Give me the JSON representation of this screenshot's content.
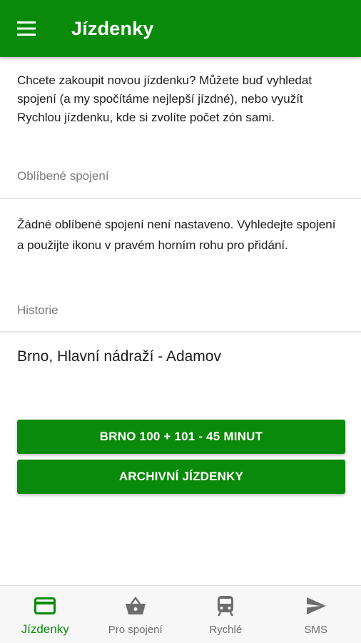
{
  "appbar": {
    "title": "Jízdenky",
    "menu_icon": "hamburger-menu-icon"
  },
  "intro": "Chcete zakoupit novou jízdenku? Můžete buď vyhledat spojení (a my spočítáme nejlepší jízdné), nebo využít Rychlou jízdenku, kde si zvolíte počet zón sami.",
  "favorites": {
    "label": "Oblíbené spojení",
    "empty_text": "Žádné oblíbené spojení není nastaveno. Vyhledejte spojení a použijte ikonu v pravém horním rohu pro přidání."
  },
  "history": {
    "label": "Historie",
    "items": [
      "Brno, Hlavní nádraží - Adamov"
    ]
  },
  "buttons": {
    "ticket_label": "BRNO 100 + 101 - 45 MINUT",
    "archive_label": "ARCHIVNÍ JÍZDENKY"
  },
  "bottom_nav": {
    "items": [
      {
        "label": "Jízdenky",
        "icon": "card-icon",
        "active": true
      },
      {
        "label": "Pro spojení",
        "icon": "basket-icon",
        "active": false
      },
      {
        "label": "Rychlé",
        "icon": "train-icon",
        "active": false
      },
      {
        "label": "SMS",
        "icon": "send-icon",
        "active": false
      }
    ]
  },
  "colors": {
    "primary": "#0a8a0a",
    "text": "#1a1a1a",
    "muted": "#7a7a7a",
    "nav_inactive": "#6d6d6d"
  }
}
